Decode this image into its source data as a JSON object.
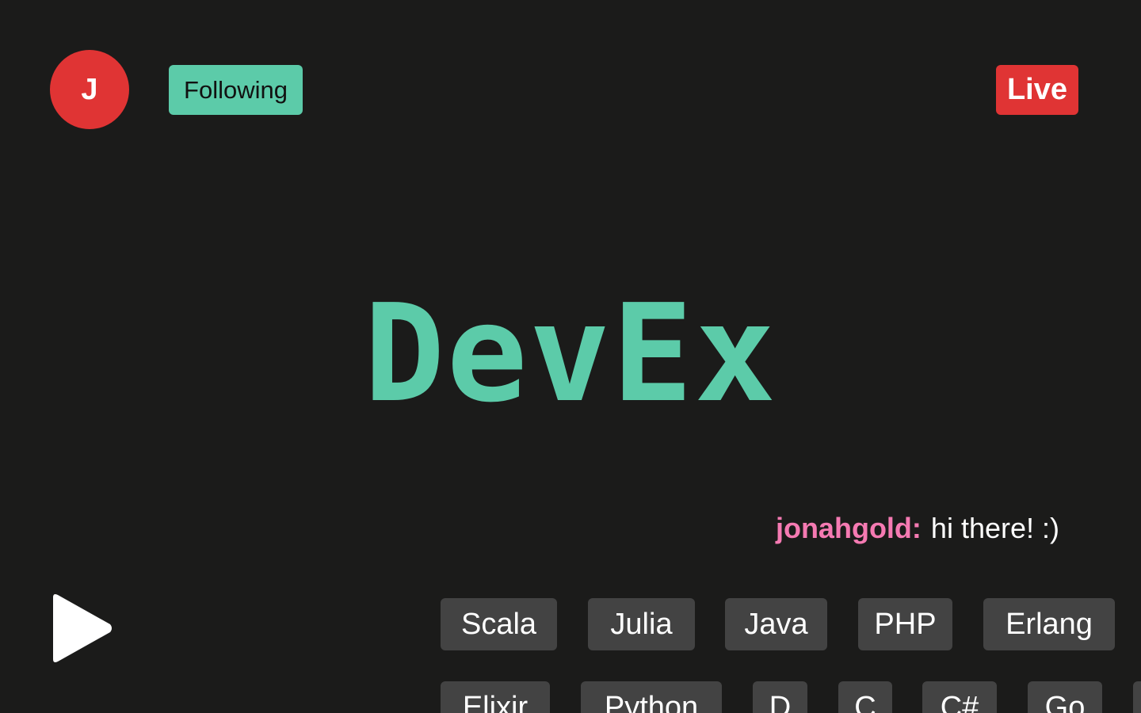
{
  "header": {
    "avatar_initial": "J",
    "follow_label": "Following",
    "live_label": "Live"
  },
  "main": {
    "title": "DevEx"
  },
  "chat": {
    "username": "jonahgold:",
    "message": "hi there! :)"
  },
  "controls": {
    "play_icon": "play-icon"
  },
  "tags": {
    "row1": [
      "Scala",
      "Julia",
      "Java",
      "PHP",
      "Erlang"
    ],
    "row2": [
      "Elixir",
      "Python",
      "D",
      "C",
      "C#",
      "Go"
    ]
  },
  "colors": {
    "background": "#1b1b1a",
    "accent": "#5ccba9",
    "live_red": "#e03434",
    "username_pink": "#f57ab2",
    "tag_bg": "#434343"
  }
}
